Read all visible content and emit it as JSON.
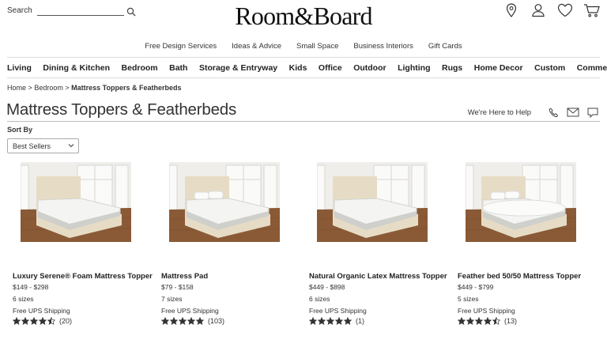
{
  "header": {
    "search_label": "Search",
    "search_placeholder": "",
    "logo_text": "Room&Board",
    "icons": [
      "location-pin-icon",
      "account-icon",
      "heart-icon",
      "cart-icon"
    ]
  },
  "utility_nav": [
    "Free Design Services",
    "Ideas & Advice",
    "Small Space",
    "Business Interiors",
    "Gift Cards"
  ],
  "category_nav": [
    "Living",
    "Dining & Kitchen",
    "Bedroom",
    "Bath",
    "Storage & Entryway",
    "Kids",
    "Office",
    "Outdoor",
    "Lighting",
    "Rugs",
    "Home Decor",
    "Custom",
    "Commercial"
  ],
  "breadcrumb": {
    "home": "Home",
    "sep1": ">",
    "bedroom": "Bedroom",
    "sep2": ">",
    "current": "Mattress Toppers & Featherbeds"
  },
  "page_title": "Mattress Toppers & Featherbeds",
  "help": {
    "label": "We're Here to Help",
    "icons": [
      "phone-icon",
      "email-icon",
      "chat-icon"
    ]
  },
  "sort": {
    "label": "Sort By",
    "selected": "Best Sellers"
  },
  "colors": {
    "star": "#333333",
    "floor": "#8a5a36",
    "bed_frame": "#e6dcc5",
    "mattress": "#f4f4f2"
  },
  "products": [
    {
      "name": "Luxury Serene® Foam Mattress Topper",
      "price": "$149 - $298",
      "sizes": "6 sizes",
      "shipping": "Free UPS Shipping",
      "rating": 4.5,
      "reviews": "(20)"
    },
    {
      "name": "Mattress Pad",
      "price": "$79 - $158",
      "sizes": "7 sizes",
      "shipping": "Free UPS Shipping",
      "rating": 5,
      "reviews": "(103)"
    },
    {
      "name": "Natural Organic Latex Mattress Topper",
      "price": "$449 - $898",
      "sizes": "6 sizes",
      "shipping": "Free UPS Shipping",
      "rating": 5,
      "reviews": "(1)"
    },
    {
      "name": "Feather bed 50/50 Mattress Topper",
      "price": "$449 - $799",
      "sizes": "5 sizes",
      "shipping": "Free UPS Shipping",
      "rating": 4.5,
      "reviews": "(13)"
    }
  ]
}
